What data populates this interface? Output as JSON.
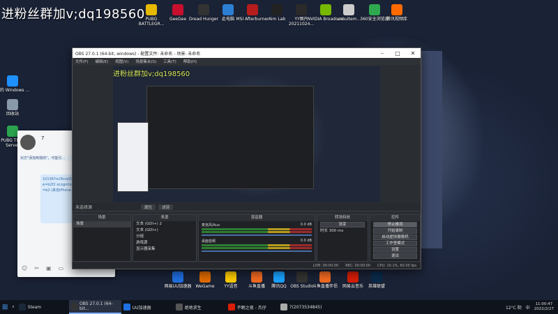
{
  "watermark": "进粉丝群加v;dq198560",
  "desktop_top_icons": [
    {
      "label": "PUBG BATTLEGR...",
      "color": "#e6b800"
    },
    {
      "label": "GeeGee",
      "color": "#c8102e"
    },
    {
      "label": "Dread Hunger",
      "color": "#333"
    },
    {
      "label": "此电脑",
      "color": "#2d7fd3"
    },
    {
      "label": "MSI Afterburner",
      "color": "#b51c1c"
    },
    {
      "label": "Aim Lab",
      "color": "#222"
    },
    {
      "label": "YY图片 20211024...",
      "color": "#2b2b2b"
    },
    {
      "label": "NVIDIA Broadcast",
      "color": "#76b900"
    },
    {
      "label": "unnuitem...",
      "color": "#ccc"
    },
    {
      "label": "360安全浏览器",
      "color": "#2fa84f"
    },
    {
      "label": "腾讯视频库",
      "color": "#ff6a00"
    }
  ],
  "desktop_left_icons": [
    {
      "label": "你的 Windows ...",
      "color": "#1e90ff"
    },
    {
      "label": "回收站",
      "color": "#8899aa"
    },
    {
      "label": "PUBG TEST Server",
      "color": "#2aa44f"
    }
  ],
  "desktop_bottom_icons": [
    {
      "label": "网易UU加速器",
      "color": "#1f6fe0"
    },
    {
      "label": "WeGame",
      "color": "#e06b00"
    },
    {
      "label": "YY语音",
      "color": "#ffcc00"
    },
    {
      "label": "斗鱼直播",
      "color": "#f26a21"
    },
    {
      "label": "腾讯QQ",
      "color": "#1aa3ff"
    },
    {
      "label": "OBS Studio",
      "color": "#333"
    },
    {
      "label": "斗鱼直播伴侣",
      "color": "#f26a21"
    },
    {
      "label": "网易云音乐",
      "color": "#d81e06"
    },
    {
      "label": "英雄联盟",
      "color": "#0a2a4a"
    }
  ],
  "obs": {
    "title": "OBS 27.0.1 (64-bit, windows) - 配置文件: 未命名 - 场景: 未命名",
    "menu": [
      "文件(F)",
      "编辑(E)",
      "视图(V)",
      "场景集合(S)",
      "工具(T)",
      "帮助(H)"
    ],
    "preview_watermark": "进粉丝群加v;dq198560",
    "no_source": "未选择源",
    "props_btn": "属性",
    "filter_btn": "滤镜",
    "scenes": {
      "title": "场景",
      "items": [
        "场景"
      ]
    },
    "sources": {
      "title": "来源",
      "items": [
        "文本 (GDI+) 2",
        "文本 (GDI+)",
        "分组",
        "游戏源",
        "显示器采集"
      ]
    },
    "mixer": {
      "title": "混音器",
      "channels": [
        {
          "name": "麦克风/Aux",
          "db": "0.0 dB"
        },
        {
          "name": "桌面音频",
          "db": "0.0 dB"
        }
      ]
    },
    "transitions": {
      "title": "转场特效",
      "type": "渐变",
      "duration_label": "时长",
      "duration": "300 ms"
    },
    "controls": {
      "title": "控件",
      "buttons": [
        "停止推流",
        "开始录制",
        "启动虚拟摄像机",
        "工作室模式",
        "设置",
        "退出"
      ]
    },
    "status": {
      "live": "LIVE: 00:00:00",
      "rec": "REC: 00:00:00",
      "cpu": "CPU: 10.1%, 60.00 fps"
    }
  },
  "chat": {
    "user": "7",
    "system_note": "对方\"添加到我的\"，可能引...",
    "message": "10136?roi3tnqlZd03e fe2333bBashTime=b2f2 xcognition=0&recordx &orign=b2 (来自iPhone YY)"
  },
  "taskbar": {
    "items": [
      {
        "label": "Steam",
        "color": "#1b2838",
        "active": false
      },
      {
        "label": "OBS 27.0.1 (64-bit...",
        "color": "#333",
        "active": true
      },
      {
        "label": "UU加速器",
        "color": "#1f6fe0",
        "active": false
      },
      {
        "label": "绝地求生",
        "color": "#555",
        "active": false
      },
      {
        "label": "不眠之夜 - 杰仔",
        "color": "#d81e06",
        "active": false
      },
      {
        "label": "7(2073534845)",
        "color": "#aaa",
        "active": false
      }
    ],
    "weather": "12°C 阴",
    "ime": "中",
    "time": "11:00:47",
    "date": "2022/2/27"
  }
}
